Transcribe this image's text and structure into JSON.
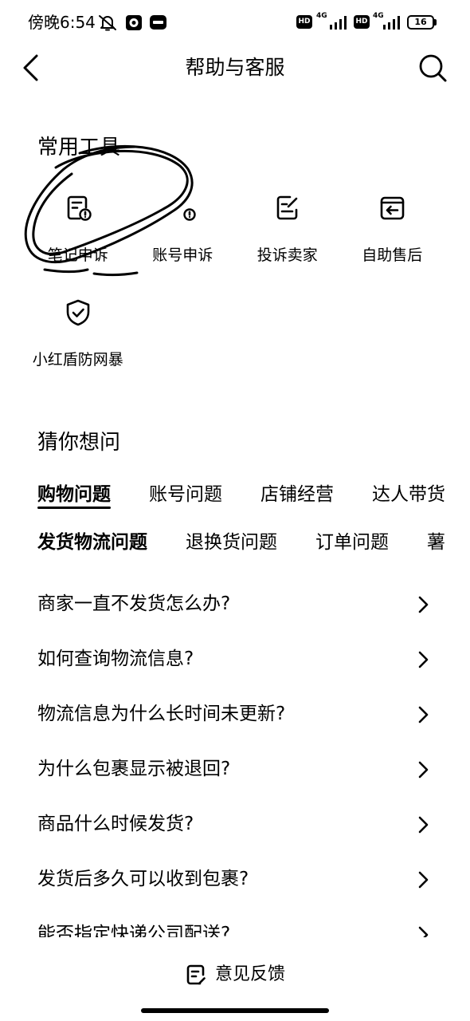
{
  "status_bar": {
    "time": "傍晚6:54",
    "left_icons": [
      "mute-bell-icon",
      "app-notification-icon",
      "app-notification-icon"
    ],
    "sim1": {
      "hd": "HD",
      "network": "4G"
    },
    "sim2": {
      "hd": "HD",
      "network": "4G"
    },
    "battery": "16"
  },
  "header": {
    "back_icon": "chevron-left-icon",
    "title": "帮助与客服",
    "search_icon": "search-icon"
  },
  "tools": {
    "title": "常用工具",
    "items": [
      {
        "label": "笔记申诉",
        "icon": "note-appeal-icon"
      },
      {
        "label": "账号申诉",
        "icon": "account-appeal-icon"
      },
      {
        "label": "投诉卖家",
        "icon": "complain-seller-icon"
      },
      {
        "label": "自助售后",
        "icon": "after-sales-return-icon"
      },
      {
        "label": "小红盾防网暴",
        "icon": "shield-check-icon"
      }
    ]
  },
  "guess": {
    "title": "猜你想问",
    "tabs": [
      {
        "label": "购物问题",
        "selected": true
      },
      {
        "label": "账号问题",
        "selected": false
      },
      {
        "label": "店铺经营",
        "selected": false
      },
      {
        "label": "达人带货",
        "selected": false
      }
    ],
    "sub_tabs": [
      {
        "label": "发货物流问题",
        "selected": true
      },
      {
        "label": "退换货问题",
        "selected": false
      },
      {
        "label": "订单问题",
        "selected": false
      },
      {
        "label": "薯",
        "selected": false
      }
    ],
    "questions": [
      "商家一直不发货怎么办?",
      "如何查询物流信息?",
      "物流信息为什么长时间未更新?",
      "为什么包裹显示被退回?",
      "商品什么时候发货?",
      "发货后多久可以收到包裹?",
      "能否指定快递公司配送?"
    ],
    "item_icon": "chevron-right-icon"
  },
  "footer": {
    "feedback_icon": "feedback-icon",
    "feedback_label": "意见反馈"
  },
  "colors": {
    "text": "#000000",
    "background": "#ffffff"
  }
}
